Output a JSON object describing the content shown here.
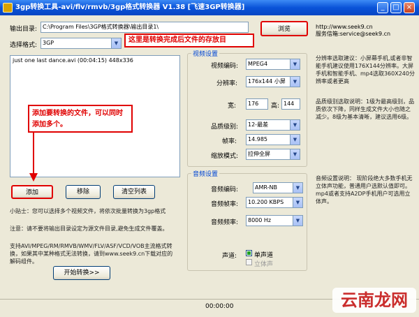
{
  "window": {
    "title": "3gp转换工具-avi/flv/rmvb/3gp格式转换器 V1.38 [飞速3GP转换器]",
    "minimize": "_",
    "maximize": "□",
    "close": "×"
  },
  "top": {
    "output_dir_label": "输出目录:",
    "output_dir_value": "C:\\Program Files\\3GP格式转换器\\输出目录1\\",
    "format_label": "选择格式:",
    "format_value": "3GP",
    "browse_button": "浏览",
    "website": "http://www.seek9.cn",
    "email": "服务信箱:service@seek9.cn"
  },
  "file_list": {
    "items": [
      "just one last dance.avi (00:04:15) 448x336"
    ]
  },
  "annotations": {
    "output_note": "这里是转换完成后文件的存放目",
    "add_note": "添加要转换的文件，可以同时添加多个。"
  },
  "buttons": {
    "add": "添加",
    "remove": "移除",
    "clear": "清空列表",
    "start": "开始转换>>"
  },
  "tips": {
    "line1": "小贴士：您可以选择多个视频文件，将依次批量转换为3gp格式",
    "line2": "注意：请不要将输出目录设定为源文件目录,避免生成文件覆盖。",
    "line3": "支持AVI/MPEG/RM/RMVB/WMV/FLV/ASF/VCD/VOB主流格式转换，如果其中某种格式无法转换，请到www.seek9.cn下载对应的解码组件。"
  },
  "video": {
    "group_title": "视频设置",
    "codec_label": "视频编码:",
    "codec_value": "MPEG4",
    "resolution_label": "分辨率:",
    "resolution_value": "176x144 小屏",
    "width_label": "宽:",
    "width_value": "176",
    "height_label": "高:",
    "height_value": "144",
    "quality_label": "品质级别:",
    "quality_value": "12-最差",
    "fps_label": "帧率:",
    "fps_value": "14.985",
    "scale_label": "缩放模式:",
    "scale_value": "拉伸全屏"
  },
  "audio": {
    "group_title": "音频设置",
    "codec_label": "音频编码:",
    "codec_value": "AMR-NB",
    "bitrate_label": "音频帧率:",
    "bitrate_value": "10.200 KBPS",
    "samplerate_label": "音频频率:",
    "samplerate_value": "8000 Hz",
    "channel_label": "声道:",
    "mono_label": "单声道",
    "stereo_label": "立体声"
  },
  "help": {
    "resolution_text": "分辨率选取建议：小屏幕手机,或者非智能手机建议使用176X144分辨率。大屏手机和智能手机、mp4选取360X240分辨率或者更高",
    "quality_text": "品质级别选取说明：1级为最高级别，品质依次下降，同样生成文件大小也随之减少。8级为基本清晰，建议选用6级。",
    "audio_text": "音频设置说明：  现阶段绝大多数手机无立体声功能，普通用户选默认值即可。mp4或者支持A2DP手机用户可选用立体声。"
  },
  "status": {
    "time": "00:00:00"
  },
  "watermark": {
    "text": "云南龙网"
  }
}
